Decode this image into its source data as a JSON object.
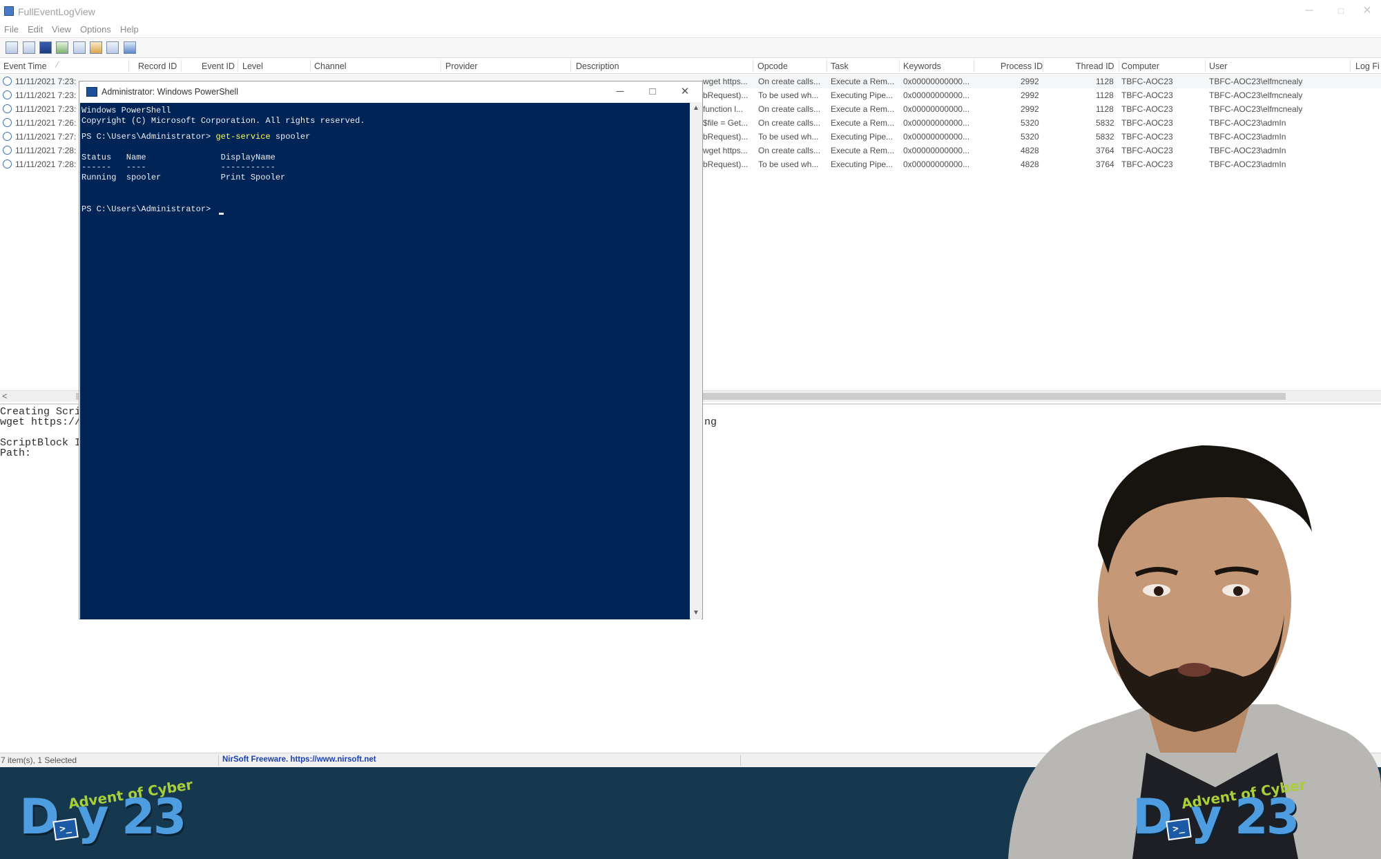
{
  "window": {
    "title": "FullEventLogView",
    "controls": {
      "minimize": "─",
      "maximize": "□",
      "close": "✕"
    }
  },
  "menu": [
    "File",
    "Edit",
    "View",
    "Options",
    "Help"
  ],
  "toolbar_icons": [
    "properties-icon",
    "html-report-icon",
    "save-icon",
    "refresh-icon",
    "copy-icon",
    "advanced-options-icon",
    "find-icon",
    "exit-icon"
  ],
  "columns": [
    "Event Time",
    "Record ID",
    "Event ID",
    "Level",
    "Channel",
    "Provider",
    "Description",
    "Opcode",
    "Task",
    "Keywords",
    "Process ID",
    "Thread ID",
    "Computer",
    "User",
    "Log Fi"
  ],
  "rows": [
    {
      "time": "11/11/2021 7:23:",
      "desc": "wget https...",
      "opcode": "On create calls...",
      "task": "Execute a Rem...",
      "keywords": "0x00000000000...",
      "pid": "2992",
      "tid": "1128",
      "computer": "TBFC-AOC23",
      "user": "TBFC-AOC23\\elfmcnealy"
    },
    {
      "time": "11/11/2021 7:23:",
      "desc": "bRequest)...",
      "opcode": "To be used wh...",
      "task": "Executing Pipe...",
      "keywords": "0x00000000000...",
      "pid": "2992",
      "tid": "1128",
      "computer": "TBFC-AOC23",
      "user": "TBFC-AOC23\\elfmcnealy"
    },
    {
      "time": "11/11/2021 7:23:",
      "desc": "function l...",
      "opcode": "On create calls...",
      "task": "Execute a Rem...",
      "keywords": "0x00000000000...",
      "pid": "2992",
      "tid": "1128",
      "computer": "TBFC-AOC23",
      "user": "TBFC-AOC23\\elfmcnealy"
    },
    {
      "time": "11/11/2021 7:26:",
      "desc": "$file = Get...",
      "opcode": "On create calls...",
      "task": "Execute a Rem...",
      "keywords": "0x00000000000...",
      "pid": "5320",
      "tid": "5832",
      "computer": "TBFC-AOC23",
      "user": "TBFC-AOC23\\admIn"
    },
    {
      "time": "11/11/2021 7:27:",
      "desc": "bRequest)...",
      "opcode": "To be used wh...",
      "task": "Executing Pipe...",
      "keywords": "0x00000000000...",
      "pid": "5320",
      "tid": "5832",
      "computer": "TBFC-AOC23",
      "user": "TBFC-AOC23\\admIn"
    },
    {
      "time": "11/11/2021 7:28:",
      "desc": "wget https...",
      "opcode": "On create calls...",
      "task": "Execute a Rem...",
      "keywords": "0x00000000000...",
      "pid": "4828",
      "tid": "3764",
      "computer": "TBFC-AOC23",
      "user": "TBFC-AOC23\\admIn"
    },
    {
      "time": "11/11/2021 7:28:",
      "desc": "bRequest)...",
      "opcode": "To be used wh...",
      "task": "Executing Pipe...",
      "keywords": "0x00000000000...",
      "pid": "4828",
      "tid": "3764",
      "computer": "TBFC-AOC23",
      "user": "TBFC-AOC23\\admIn"
    }
  ],
  "details_pane": {
    "line1": "Creating Scri",
    "line2": "wget https://",
    "line3": "ScriptBlock I",
    "line4": "Path:",
    "right_fragment": "ng"
  },
  "status": {
    "items": "7 item(s), 1 Selected",
    "credit": "NirSoft Freeware. https://www.nirsoft.net"
  },
  "powershell": {
    "title": "Administrator: Windows PowerShell",
    "header": "Windows PowerShell",
    "copyright": "Copyright (C) Microsoft Corporation. All rights reserved.",
    "prompt1": "PS C:\\Users\\Administrator>",
    "command": "get-service",
    "command_arg": "spooler",
    "table_header": "Status   Name               DisplayName",
    "table_rule": "------   ----               -----------",
    "table_row": "Running  spooler            Print Spooler",
    "prompt2": "PS C:\\Users\\Administrator>"
  },
  "branding": {
    "advent": "Advent of Cyber",
    "day": "Day 23",
    "day_d": "D",
    "day_y": "y 23",
    "ps_glyph": ">_"
  },
  "colors": {
    "ps_background": "#012456",
    "ps_command": "#fdfd54",
    "banner": "#15384f",
    "advent_green": "#a8cf3a",
    "day_blue": "#4d9de0",
    "status_link": "#1a3fb0"
  }
}
